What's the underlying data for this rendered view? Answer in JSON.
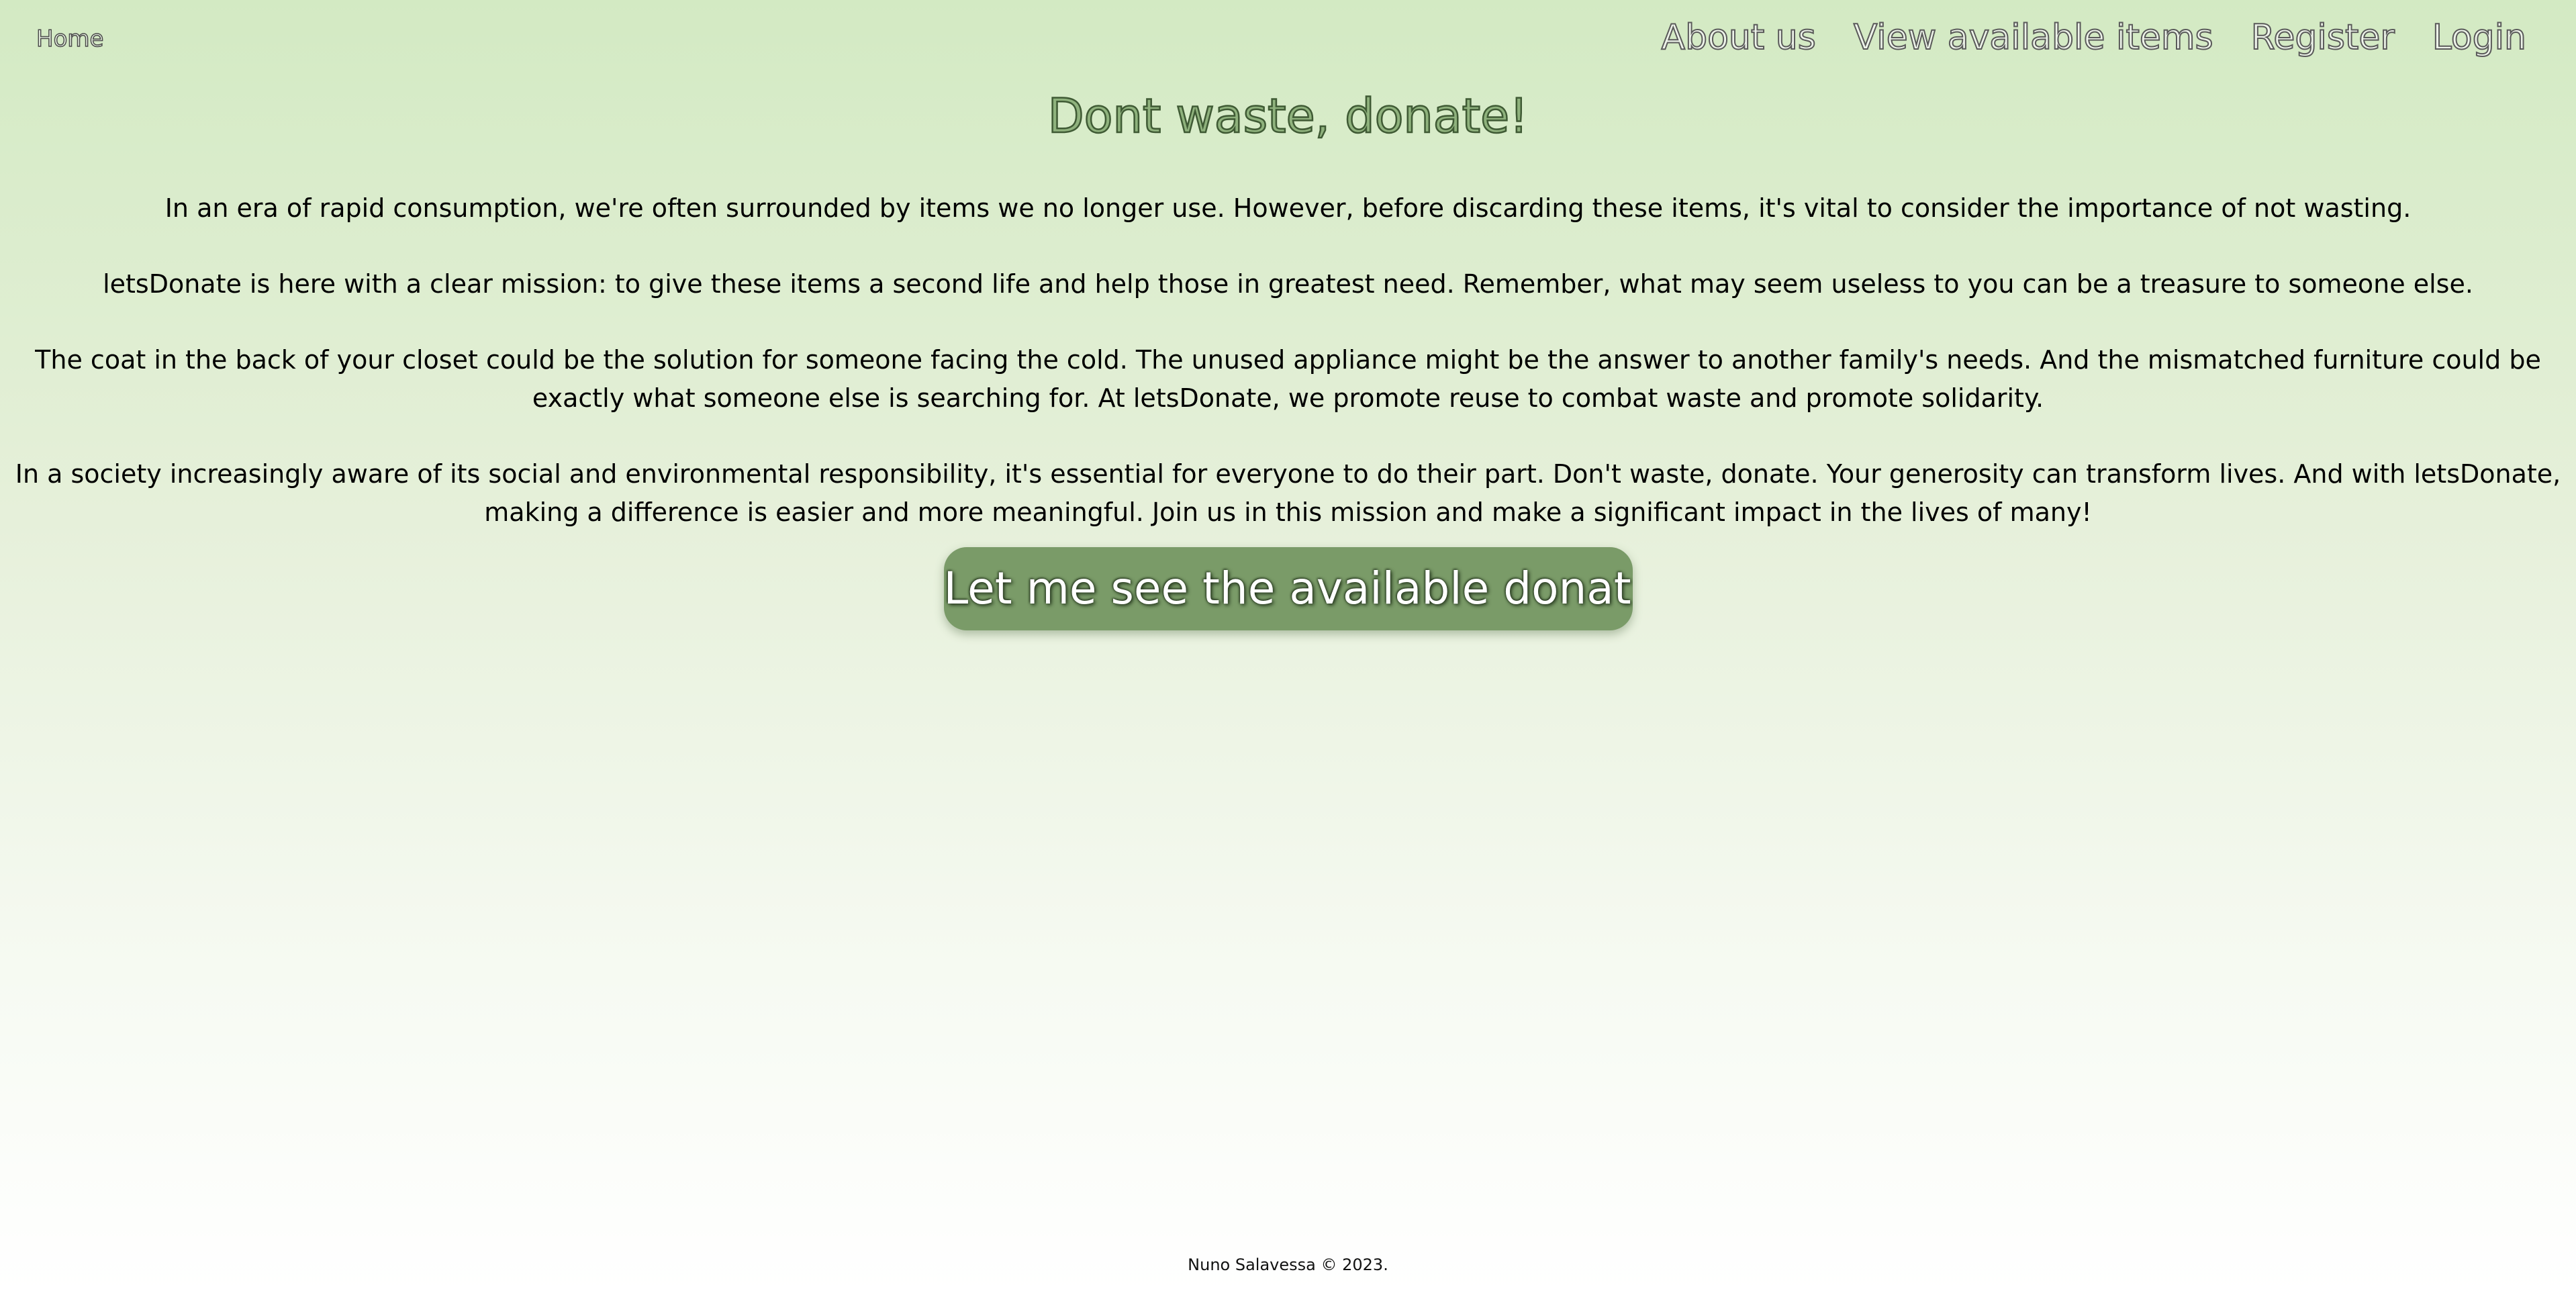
{
  "nav": {
    "home": "Home",
    "links": [
      "About us",
      "View available items",
      "Register",
      "Login"
    ]
  },
  "main": {
    "title": "Dont waste, donate!",
    "paragraphs": [
      "In an era of rapid consumption, we're often surrounded by items we no longer use. However, before discarding these items, it's vital to consider the importance of not wasting.",
      "letsDonate is here with a clear mission: to give these items a second life and help those in greatest need. Remember, what may seem useless to you can be a treasure to someone else.",
      "The coat in the back of your closet could be the solution for someone facing the cold. The unused appliance might be the answer to another family's needs. And the mismatched furniture could be exactly what someone else is searching for. At letsDonate, we promote reuse to combat waste and promote solidarity.",
      "In a society increasingly aware of its social and environmental responsibility, it's essential for everyone to do their part. Don't waste, donate. Your generosity can transform lives. And with letsDonate, making a difference is easier and more meaningful. Join us in this mission and make a significant impact in the lives of many!"
    ],
    "cta_label": "Let me see the available donations"
  },
  "footer": {
    "text": "Nuno Salavessa © 2023."
  },
  "colors": {
    "accent": "#7a9b68",
    "background_top": "#d3eac3",
    "background_bottom": "#ffffff"
  }
}
